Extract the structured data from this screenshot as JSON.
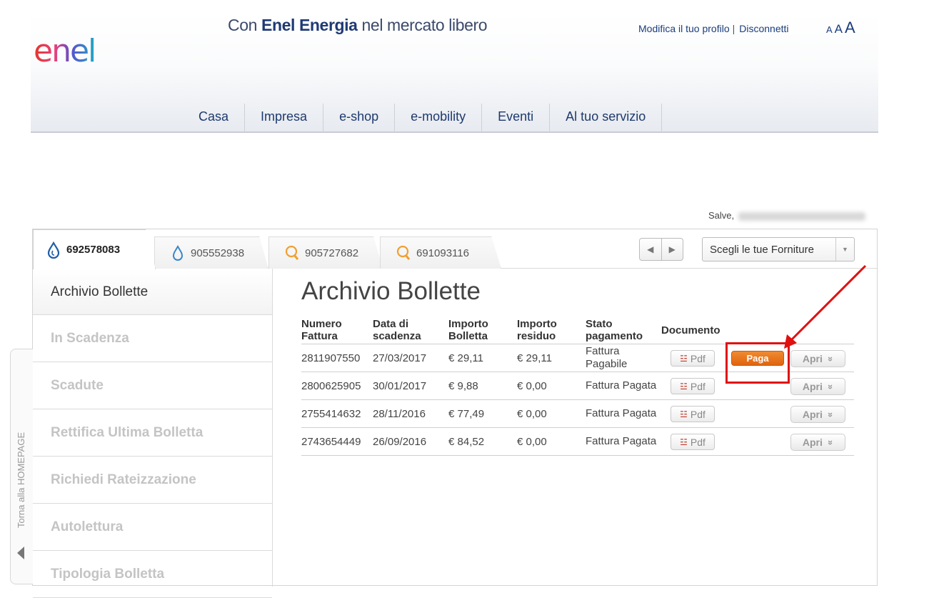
{
  "header": {
    "logo_text": "enel",
    "tagline_prefix": "Con",
    "tagline_brand": "Enel Energia",
    "tagline_suffix": "nel mercato libero",
    "links": {
      "profile": "Modifica il tuo profilo",
      "separator": "|",
      "logout": "Disconnetti"
    },
    "font_sizes": [
      "A",
      "A",
      "A"
    ],
    "nav": [
      "Casa",
      "Impresa",
      "e-shop",
      "e-mobility",
      "Eventi",
      "Al tuo servizio"
    ]
  },
  "greeting": "Salve,",
  "supplies": {
    "tabs": [
      {
        "number": "692578083",
        "icon": "gas-drop-icon",
        "active": true
      },
      {
        "number": "905552938",
        "icon": "gas-drop-icon",
        "active": false
      },
      {
        "number": "905727682",
        "icon": "light-bulb-icon",
        "active": false
      },
      {
        "number": "691093116",
        "icon": "light-bulb-icon",
        "active": false
      }
    ],
    "select_label": "Scegli le tue Forniture"
  },
  "menu": [
    "Archivio Bollette",
    "In Scadenza",
    "Scadute",
    "Rettifica Ultima Bolletta",
    "Richiedi Rateizzazione",
    "Autolettura",
    "Tipologia Bolletta"
  ],
  "side_tab": "Torna alla HOMEPAGE",
  "content": {
    "title": "Archivio Bollette",
    "columns": [
      "Numero Fattura",
      "Data di scadenza",
      "Importo Bolletta",
      "Importo residuo",
      "Stato pagamento",
      "Documento"
    ],
    "rows": [
      {
        "numero": "2811907550",
        "data": "27/03/2017",
        "importo": "€ 29,11",
        "residuo": "€ 29,11",
        "stato": "Fattura Pagabile",
        "pay": true
      },
      {
        "numero": "2800625905",
        "data": "30/01/2017",
        "importo": "€ 9,88",
        "residuo": "€ 0,00",
        "stato": "Fattura Pagata",
        "pay": false
      },
      {
        "numero": "2755414632",
        "data": "28/11/2016",
        "importo": "€ 77,49",
        "residuo": "€ 0,00",
        "stato": "Fattura Pagata",
        "pay": false
      },
      {
        "numero": "2743654449",
        "data": "26/09/2016",
        "importo": "€ 84,52",
        "residuo": "€ 0,00",
        "stato": "Fattura Pagata",
        "pay": false
      }
    ],
    "buttons": {
      "pdf": "Pdf",
      "pay": "Paga",
      "open": "Apri"
    }
  },
  "colors": {
    "brand_blue": "#1f3a73",
    "pay_orange": "#e0640e",
    "highlight_red": "#e01010"
  }
}
